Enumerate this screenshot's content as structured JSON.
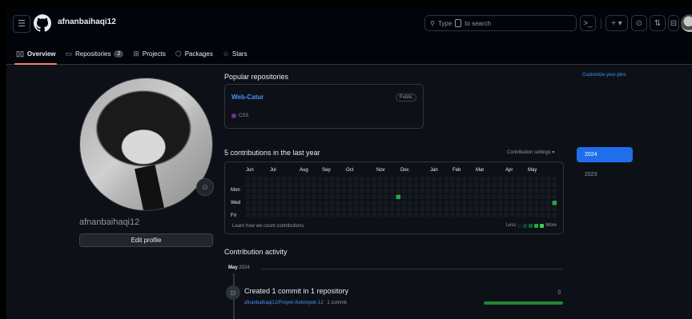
{
  "colors": {
    "accent": "#1f6feb",
    "link": "#4493f8",
    "contrib_high": "#26a641",
    "contrib_empty": "#161b22",
    "lang_css": "#663399"
  },
  "header": {
    "username": "afnanbaihaqi12",
    "search_placeholder_a": "Type",
    "search_placeholder_b": "to search",
    "icons": [
      "menu-icon",
      "github-logo-icon",
      "search-icon",
      "terminal-icon",
      "plus-icon",
      "issues-icon",
      "pull-requests-icon",
      "inbox-icon"
    ]
  },
  "tabs": [
    {
      "label": "Overview",
      "icon": "book-icon",
      "active": true
    },
    {
      "label": "Repositories",
      "icon": "repo-icon",
      "count": "2"
    },
    {
      "label": "Projects",
      "icon": "table-icon"
    },
    {
      "label": "Packages",
      "icon": "package-icon"
    },
    {
      "label": "Stars",
      "icon": "star-icon"
    }
  ],
  "profile": {
    "name": "afnanbaihaqi12",
    "edit_label": "Edit profile"
  },
  "pinned": {
    "title": "Popular repositories",
    "customize": "Customize your pins",
    "repo": {
      "name": "Web-Catur",
      "visibility": "Public",
      "language": "CSS"
    }
  },
  "contributions": {
    "title": "5 contributions in the last year",
    "settings": "Contribution settings",
    "months": [
      "Jun",
      "Jul",
      "Aug",
      "Sep",
      "Oct",
      "Nov",
      "Dec",
      "Jan",
      "Feb",
      "Mar",
      "Apr",
      "May"
    ],
    "days": [
      "Mon",
      "Wed",
      "Fri"
    ],
    "learn": "Learn how we count contributions",
    "less": "Less",
    "more": "More",
    "active_cells": [
      {
        "week": 25,
        "day": 3
      },
      {
        "week": 51,
        "day": 4
      }
    ]
  },
  "years": {
    "selected": "2024",
    "other": "2023"
  },
  "activity": {
    "title": "Contribution activity",
    "month": "May",
    "year": "2024",
    "commit_title": "Created 1 commit in 1 repository",
    "commit_repo": "afnanbaihaqi12/Proyek-Kelompok-12",
    "commit_count": "1 commit",
    "commit_fraction": 1.0
  }
}
